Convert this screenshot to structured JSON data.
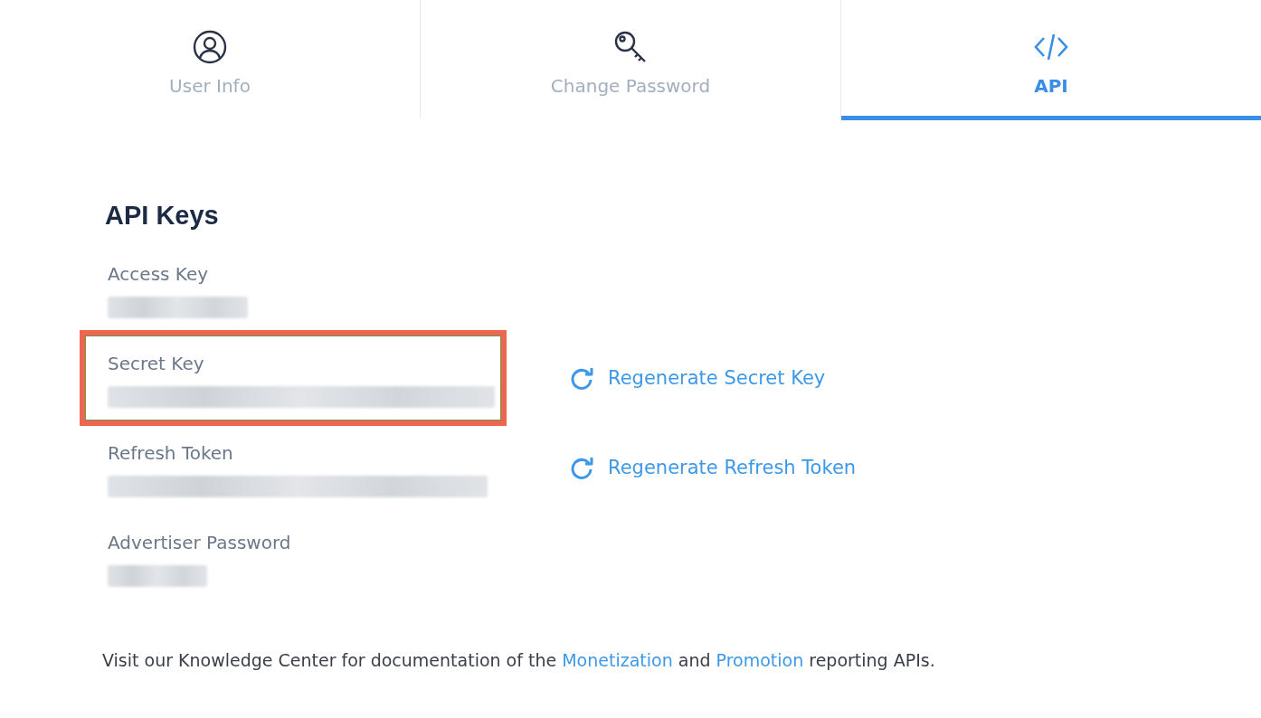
{
  "tabs": [
    {
      "label": "User Info",
      "kind": "user",
      "selected": false
    },
    {
      "label": "Change Password",
      "kind": "key",
      "selected": false
    },
    {
      "label": "API",
      "kind": "code",
      "selected": true
    }
  ],
  "heading": "API Keys",
  "fields": [
    {
      "label": "Access Key",
      "highlighted": false
    },
    {
      "label": "Secret Key",
      "highlighted": true,
      "action": "Regenerate Secret Key"
    },
    {
      "label": "Refresh Token",
      "highlighted": false,
      "action": "Regenerate Refresh Token"
    },
    {
      "label": "Advertiser Password",
      "highlighted": false
    }
  ],
  "footer": [
    {
      "kind": "text",
      "text": "Visit our Knowledge Center for documentation of the "
    },
    {
      "kind": "link",
      "text": "Monetization"
    },
    {
      "kind": "text",
      "text": " and "
    },
    {
      "kind": "link",
      "text": "Promotion"
    },
    {
      "kind": "text",
      "text": " reporting APIs."
    }
  ]
}
